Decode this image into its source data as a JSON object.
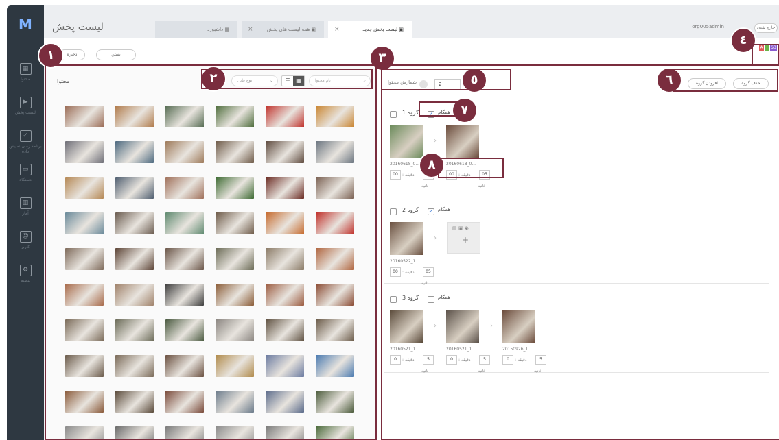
{
  "app": {
    "title": "لیست پخش",
    "logo": "M",
    "user": "org005admin",
    "logout": "خارج شدن",
    "badges": [
      "A",
      "I",
      "S3"
    ]
  },
  "nav": [
    {
      "icon": "grid-icon",
      "label": "محتوا",
      "glyph": "▦"
    },
    {
      "icon": "play-icon",
      "label": "لیست پخش",
      "glyph": "▶"
    },
    {
      "icon": "calendar-icon",
      "label": "برنامه زمان نمایش داده",
      "glyph": "✓"
    },
    {
      "icon": "monitor-icon",
      "label": "دستگاه",
      "glyph": "▭"
    },
    {
      "icon": "chart-icon",
      "label": "آمار",
      "glyph": "▥"
    },
    {
      "icon": "user-icon",
      "label": "کاربر",
      "glyph": "☺"
    },
    {
      "icon": "settings-icon",
      "label": "تنظیم",
      "glyph": "⚙"
    }
  ],
  "tabs": [
    {
      "label": "داشبورد",
      "icon": "▦"
    },
    {
      "label": "همه لیست های پخش",
      "icon": "▣",
      "close": "×"
    },
    {
      "label": "لیست پخش جدید",
      "icon": "▣",
      "close": "×"
    }
  ],
  "toolbar": {
    "save": "ذخیره",
    "close": "بستن"
  },
  "left": {
    "title": "محتوا",
    "search_placeholder": "نام محتوا",
    "type_placeholder": "نوع فایل",
    "view": [
      "☰",
      "▦"
    ],
    "thumb_colors": [
      "#9a6b55",
      "#b07a4a",
      "#556b52",
      "#4c6b3a",
      "#c0302a",
      "#c9842f",
      "#6f6f78",
      "#4e6a80",
      "#9e7a5a",
      "#6e5a48",
      "#5e4a3e",
      "#6b7580",
      "#b58854",
      "#4f5e70",
      "#a0705a",
      "#3d6a32",
      "#6a2a22",
      "#7a6052",
      "#6a8a9a",
      "#6b5c50",
      "#5f8a70",
      "#6d5a48",
      "#c66a2d",
      "#c0302a",
      "#7e6a5a",
      "#5c4436",
      "#6a5548",
      "#6a6a55",
      "#8a7a66",
      "#b0653f",
      "#a86a4a",
      "#a0826a",
      "#3e3e3e",
      "#8a5b36",
      "#9b5a3f",
      "#8a4a32",
      "#7a6a58",
      "#6b6b58",
      "#4a5a40",
      "#8a8580",
      "#5e5040",
      "#6a5a48",
      "#6a5a4a",
      "#7a6a58",
      "#6a5040",
      "#b08a4a",
      "#6a7aa0",
      "#4a7ab0",
      "#8a5a3a",
      "#5a4a3a",
      "#7a4a3a",
      "#6a7a8a",
      "#5a6a8a",
      "#4a5a3a",
      "#8a8a8a",
      "#6a6a6a",
      "#7a7a7a",
      "#8a8a8a",
      "#7a7a7a",
      "#4a6a3a"
    ]
  },
  "right": {
    "sort_label": "شمارش محتوا",
    "sort_value": "2",
    "add_group": "افزودن گروه",
    "delete_group": "حذف گروه",
    "sync_label": "همگام",
    "minute_label": ": دقیقه",
    "second_label": "ثانیه",
    "groups": [
      {
        "title": "گروه 1",
        "sync": true,
        "items": [
          {
            "name": "20160618_0...",
            "min": "00",
            "sec": "00",
            "color": "#6a8a5a"
          },
          {
            "name": "20160618_0...",
            "min": "00",
            "sec": "05",
            "color": "#6a4a3a"
          }
        ]
      },
      {
        "title": "گروه 2",
        "sync": true,
        "items": [
          {
            "name": "20160522_1...",
            "min": "00",
            "sec": "05",
            "color": "#6a5040"
          }
        ]
      },
      {
        "title": "گروه 3",
        "sync": false,
        "items": [
          {
            "name": "20160521_1...",
            "min": "0",
            "sec": "5",
            "color": "#5a4a3a"
          },
          {
            "name": "20160521_1...",
            "min": "0",
            "sec": "5",
            "color": "#5a5048"
          },
          {
            "name": "20150926_1...",
            "min": "0",
            "sec": "5",
            "color": "#6a4a3a"
          }
        ]
      }
    ]
  },
  "markers": [
    "١",
    "٢",
    "٣",
    "٤",
    "٥",
    "٦",
    "٧",
    "٨"
  ]
}
